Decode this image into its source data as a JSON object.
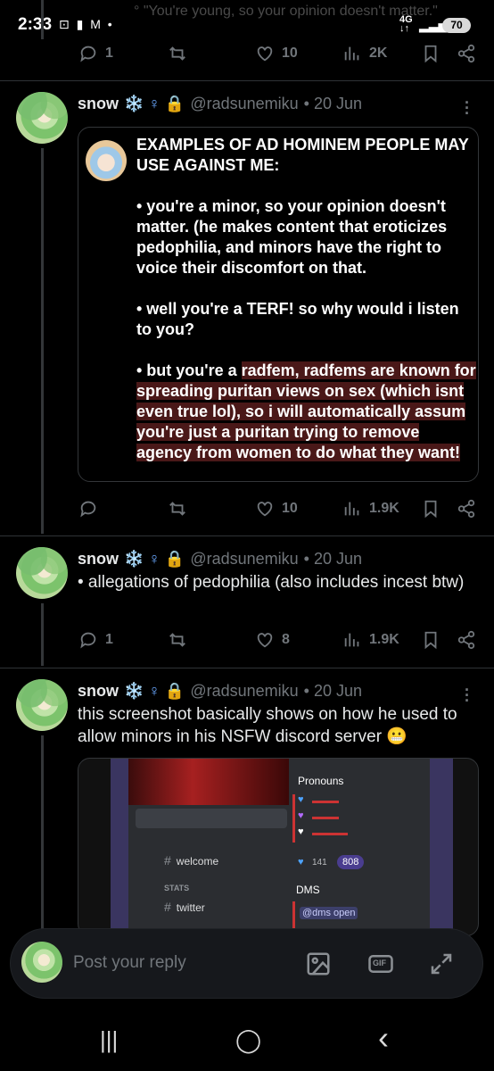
{
  "status_bar": {
    "time": "2:33",
    "left_icons": "⊡ ▮ M •",
    "ghost_text": "° \"You're young, so your opinion doesn't matter.\"",
    "network": "4G",
    "network_sub": "↓↑",
    "signal": "▂▃▅",
    "battery": "70"
  },
  "top_actions": {
    "replies": "1",
    "likes": "10",
    "views": "2K"
  },
  "posts": [
    {
      "name": "snow",
      "badges": "❄️ ♀ 🔒",
      "handle": "@radsunemiku",
      "date": "• 20 Jun",
      "more": "⋮",
      "quote": {
        "title": "EXAMPLES OF AD HOMINEM PEOPLE MAY USE AGAINST ME:",
        "item1": "• you're a minor, so your opinion doesn't matter. (he makes content that eroticizes pedophilia, and minors have the right to voice their discomfort on that.",
        "item2": "• well you're a TERF! so why would i listen to you?",
        "item3_plain": "• but you're a ",
        "item3_hl": "radfem, radfems are known for spreading puritan views on sex (which isnt even true lol), so i will automatically assum you're just a puritan trying to remove agency from women to do what they want!"
      },
      "actions": {
        "replies": "",
        "likes": "10",
        "views": "1.9K"
      }
    },
    {
      "name": "snow",
      "badges": "❄️ ♀ 🔒",
      "handle": "@radsunemiku",
      "date": "• 20 Jun",
      "text": "• allegations of pedophilia (also includes incest btw)",
      "actions": {
        "replies": "1",
        "likes": "8",
        "views": "1.9K"
      }
    },
    {
      "name": "snow",
      "badges": "❄️ ♀ 🔒",
      "handle": "@radsunemiku",
      "date": "• 20 Jun",
      "more": "⋮",
      "text": "this screenshot basically shows on how he used to allow minors in his NSFW discord server 😬",
      "image": {
        "channels": [
          "welcome",
          "twitter"
        ],
        "category": "STATS",
        "pronouns_label": "Pronouns",
        "count_a": "141",
        "count_b": "808",
        "dms_label": "DMS",
        "dms_open": "@dms open"
      }
    }
  ],
  "reply_bar": {
    "placeholder": "Post your reply",
    "gif": "GIF"
  },
  "nav": {
    "recents": "|||",
    "home": "◯",
    "back": "‹"
  }
}
